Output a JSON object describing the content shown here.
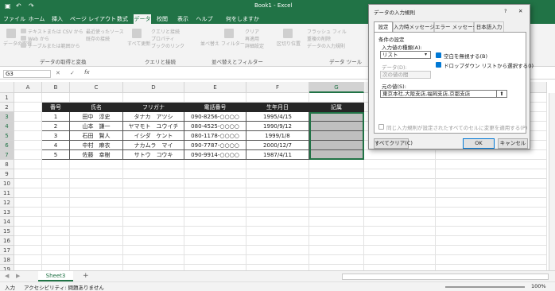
{
  "titlebar": {
    "file_label": "ファイル",
    "doc_title": "Book1  -  Excel",
    "undo_symbol": "↶",
    "redo_symbol": "↷",
    "save_symbol": "▣",
    "controls": [
      "—",
      "☐",
      "✕"
    ]
  },
  "tabs": [
    "ファイル",
    "ホーム",
    "挿入",
    "ページ レイアウト",
    "数式",
    "データ",
    "校閲",
    "表示",
    "ヘルプ",
    "何をしますか"
  ],
  "active_tab": "データ",
  "ribbon": {
    "items": [
      "テキストまたは CSV から",
      "Web から",
      "テーブルまたは範囲から",
      "最近使ったソース",
      "既存の接続",
      "すべて更新",
      "クエリと接続",
      "プロパティ",
      "ブックのリンク",
      "クリア",
      "再適用",
      "詳細設定",
      "フラッシュ フィル",
      "重複の削除",
      "データの入力規則",
      "区切り位置",
      "データの取得",
      "フィルター",
      "並べ替え"
    ],
    "groups": [
      "データの取得と変換",
      "クエリと接続",
      "並べ替えとフィルター",
      "データ ツール"
    ]
  },
  "formula_bar": {
    "name_box": "G3",
    "fx": "fx",
    "value": ""
  },
  "columns": [
    "A",
    "B",
    "C",
    "D",
    "E",
    "F",
    "G",
    "H",
    "I"
  ],
  "selected_column": "G",
  "rows": [
    "1",
    "2",
    "3",
    "4",
    "5",
    "6",
    "7",
    "8",
    "9",
    "10",
    "11",
    "12",
    "13",
    "14",
    "15",
    "16",
    "17",
    "18",
    "19"
  ],
  "table": {
    "headers": [
      "番号",
      "氏名",
      "フリガナ",
      "電話番号",
      "生年月日",
      "記属"
    ],
    "records": [
      [
        "1",
        "田中　淳史",
        "タナカ　アツシ",
        "090-8256-○○○○",
        "1995/4/15",
        ""
      ],
      [
        "2",
        "山本　謙一",
        "ヤマモト　ユウイチ",
        "080-4525-○○○○",
        "1990/9/12",
        ""
      ],
      [
        "3",
        "石田　賢人",
        "イシダ　ケント",
        "080-1178-○○○○",
        "1999/1/8",
        ""
      ],
      [
        "4",
        "中村　麻衣",
        "ナカムラ　マイ",
        "090-7787-○○○○",
        "2000/12/7",
        ""
      ],
      [
        "5",
        "佐藤　幸樹",
        "サトウ　コウキ",
        "090-9914-○○○○",
        "1987/4/11",
        ""
      ]
    ]
  },
  "sheet_tab": "Sheet3",
  "add_sheet": "+",
  "status": {
    "mode": "入力",
    "accessibility": "アクセシビリティ: 問題ありません",
    "zoom": "100%"
  },
  "dialog": {
    "title": "データの入力規則",
    "help": "?",
    "close": "✕",
    "tabs": [
      "設定",
      "入力時メッセージ",
      "エラー メッセージ",
      "日本語入力"
    ],
    "section": "条件の設定",
    "allow_label": "入力値の種類(A):",
    "allow_value": "リスト",
    "ignore_blank": "空白を無視する(B)",
    "in_cell_dropdown": "ドロップダウン リストから選択する(I)",
    "data_label": "データ(D):",
    "data_value": "次の値の間",
    "source_label": "元の値(S):",
    "source_value": "東京本社,大阪支店,福岡支店,京都支店",
    "apply_all": "同じ入力規則が設定されたすべてのセルに変更を適用する(P)",
    "clear_all": "すべてクリア(C)",
    "ok": "OK",
    "cancel": "キャンセル"
  },
  "colors": {
    "excel_green": "#217346",
    "header_black": "#262626",
    "selection_gray": "#bfbfbf",
    "dialog_bg": "#f0f0f0",
    "check_blue": "#0078d4"
  }
}
